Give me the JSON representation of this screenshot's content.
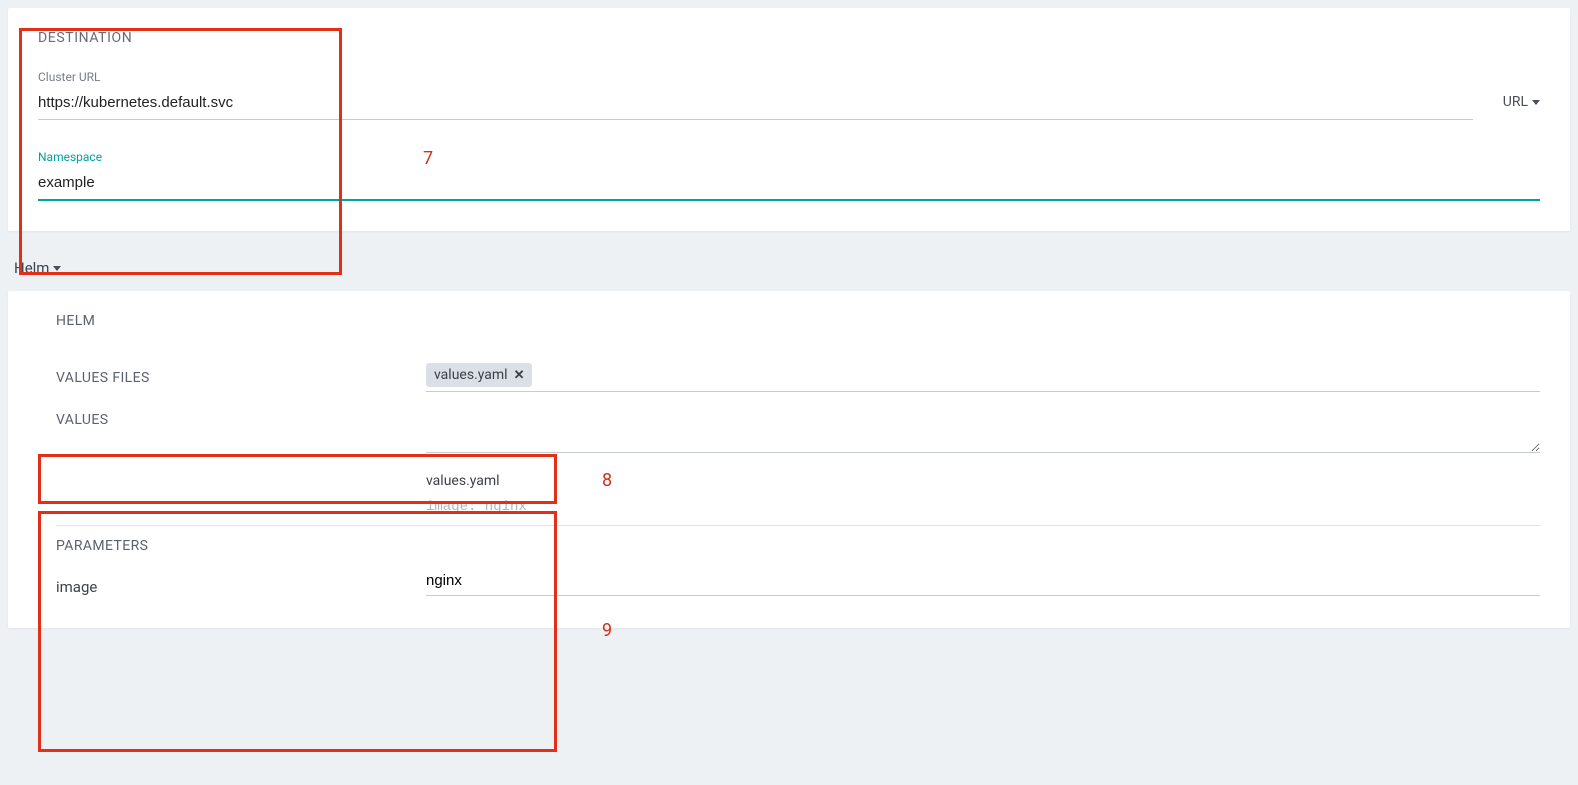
{
  "destination": {
    "heading": "DESTINATION",
    "cluster_url_label": "Cluster URL",
    "cluster_url_value": "https://kubernetes.default.svc",
    "url_type_label": "URL",
    "namespace_label": "Namespace",
    "namespace_value": "example"
  },
  "source_type": {
    "selected": "Helm"
  },
  "helm": {
    "heading": "HELM",
    "values_files_label": "VALUES FILES",
    "values_files_chip": "values.yaml",
    "values_label": "VALUES",
    "values_textarea": "",
    "preview_filename": "values.yaml",
    "preview_content": "image: nginx",
    "parameters_label": "PARAMETERS",
    "params": [
      {
        "key": "image",
        "value": "nginx"
      }
    ]
  },
  "annotations": {
    "n7": "7",
    "n8": "8",
    "n9": "9"
  }
}
